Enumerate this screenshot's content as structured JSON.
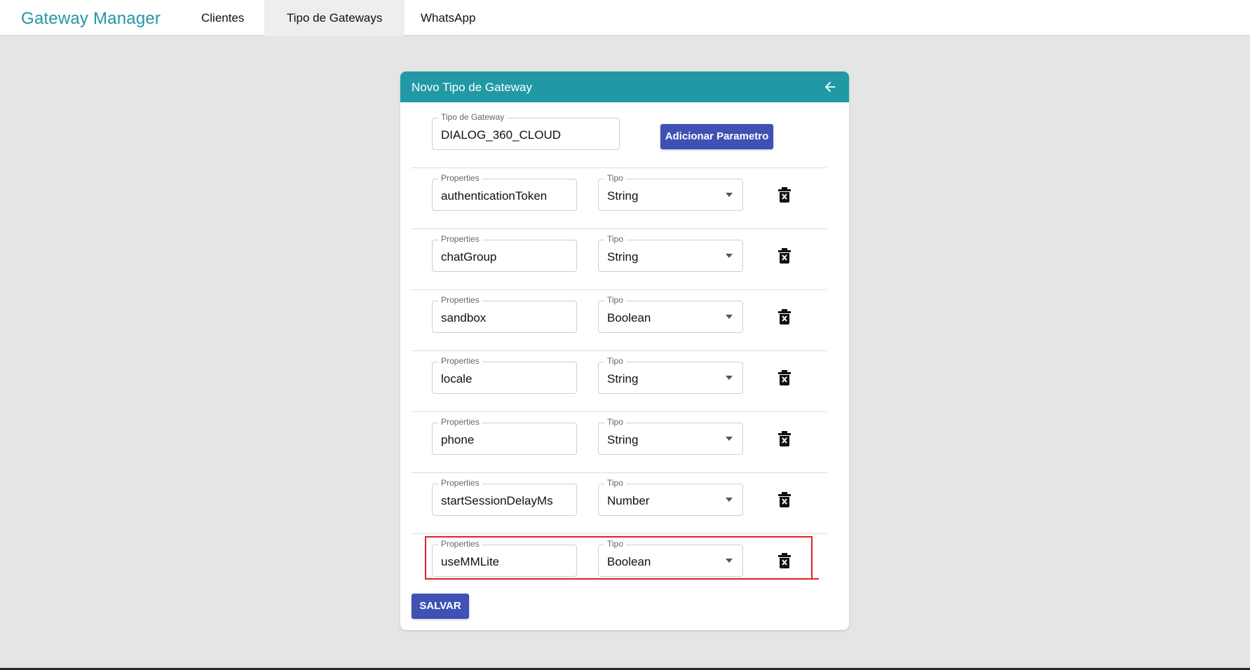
{
  "app": {
    "brand": "Gateway Manager",
    "tabs": [
      {
        "label": "Clientes",
        "active": false
      },
      {
        "label": "Tipo de Gateways",
        "active": true
      },
      {
        "label": "WhatsApp",
        "active": false
      }
    ]
  },
  "card": {
    "title": "Novo Tipo de Gateway",
    "header_color": "#2199a4",
    "back_icon": "arrow-left-icon",
    "gateway_type": {
      "label": "Tipo de Gateway",
      "value": "DIALOG_360_CLOUD"
    },
    "add_param_label": "Adicionar Parametro",
    "save_label": "SALVAR",
    "properties_label": "Properties",
    "tipo_label": "Tipo",
    "rows": [
      {
        "property": "authenticationToken",
        "type": "String"
      },
      {
        "property": "chatGroup",
        "type": "String"
      },
      {
        "property": "sandbox",
        "type": "Boolean"
      },
      {
        "property": "locale",
        "type": "String"
      },
      {
        "property": "phone",
        "type": "String"
      },
      {
        "property": "startSessionDelayMs",
        "type": "Number"
      },
      {
        "property": "useMMLite",
        "type": "Boolean"
      }
    ]
  },
  "colors": {
    "primary_button": "#3f51b5",
    "highlight": "#e02020",
    "brand": "#2196a6"
  }
}
